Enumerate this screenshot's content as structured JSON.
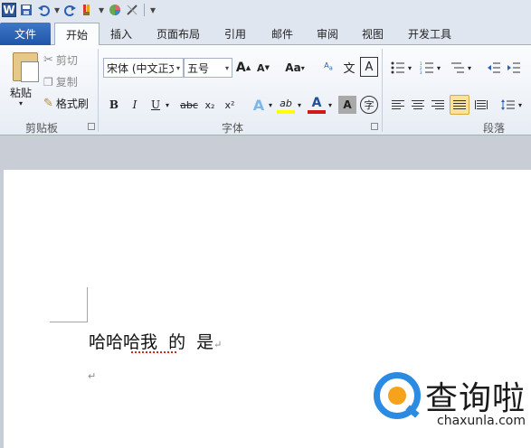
{
  "qat": {
    "word_icon": "W",
    "icons": [
      "word-icon",
      "save-icon",
      "undo-icon",
      "redo-icon",
      "brush-icon",
      "color-icon",
      "pen-icon",
      "customize-icon"
    ]
  },
  "tabs": [
    {
      "label": "文件",
      "key": "file"
    },
    {
      "label": "开始",
      "key": "home"
    },
    {
      "label": "插入",
      "key": "insert"
    },
    {
      "label": "页面布局",
      "key": "layout"
    },
    {
      "label": "引用",
      "key": "references"
    },
    {
      "label": "邮件",
      "key": "mailings"
    },
    {
      "label": "审阅",
      "key": "review"
    },
    {
      "label": "视图",
      "key": "view"
    },
    {
      "label": "开发工具",
      "key": "developer"
    }
  ],
  "clipboard": {
    "paste": "粘贴",
    "cut": "剪切",
    "copy": "复制",
    "format_painter": "格式刷",
    "label": "剪贴板"
  },
  "font": {
    "font_name": "宋体 (中文正文",
    "font_size": "五号",
    "label": "字体",
    "bold": "B",
    "italic": "I",
    "underline": "U",
    "strike": "abc",
    "sub": "x₂",
    "sup": "x²",
    "grow": "A",
    "shrink": "A",
    "change_case": "Aa",
    "font_color": "A",
    "char_shading": "A",
    "enclose": "字",
    "highlight": "ab",
    "phonetic": "wén",
    "text_effect": "A"
  },
  "paragraph": {
    "label": "段落"
  },
  "document": {
    "text": "哈哈哈我  的  是",
    "para_mark": "↵"
  },
  "watermark": {
    "title": "查询啦",
    "url": "chaxunla.com"
  },
  "colors": {
    "accent": "#2b5797",
    "file_tab": "#2a62b6",
    "highlight": "#fbe29a",
    "font_red": "#d11818",
    "highlight_yellow": "#ffff00",
    "watermark_blue": "#2b8be3",
    "watermark_orange": "#f6a21b"
  }
}
